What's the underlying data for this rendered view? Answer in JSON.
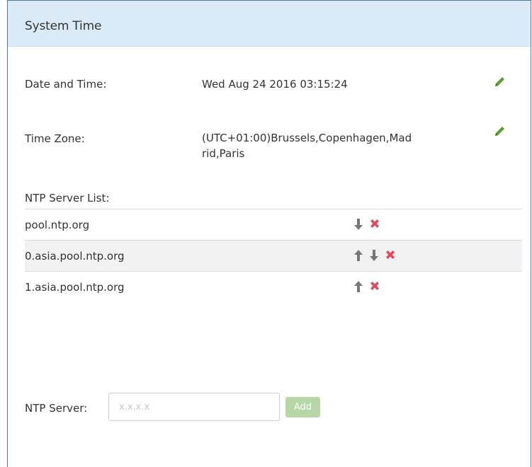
{
  "panel": {
    "title": "System Time"
  },
  "date_time": {
    "label": "Date and Time:",
    "value": "Wed Aug 24 2016 03:15:24",
    "edit_icon": "pencil-icon"
  },
  "time_zone": {
    "label": "Time Zone:",
    "value_line1": "(UTC+01:00)Brussels,Copenhagen,Mad",
    "value_line2": "rid,Paris",
    "edit_icon": "pencil-icon"
  },
  "ntp_list": {
    "label": "NTP Server List:",
    "servers": [
      {
        "host": "pool.ntp.org",
        "actions": [
          "move-down-icon",
          "delete-icon"
        ]
      },
      {
        "host": "0.asia.pool.ntp.org",
        "actions": [
          "move-up-icon",
          "move-down-icon",
          "delete-icon"
        ]
      },
      {
        "host": "1.asia.pool.ntp.org",
        "actions": [
          "move-up-icon",
          "delete-icon"
        ]
      }
    ]
  },
  "ntp_form": {
    "label": "NTP Server:",
    "placeholder": "x.x.x.x",
    "value": "",
    "add_label": "Add"
  },
  "colors": {
    "header_bg": "#daeaf6",
    "edit_icon": "#5aa02c",
    "delete_icon": "#e8455a",
    "arrow_icon": "#777777",
    "add_button": "#b7d8a6"
  }
}
